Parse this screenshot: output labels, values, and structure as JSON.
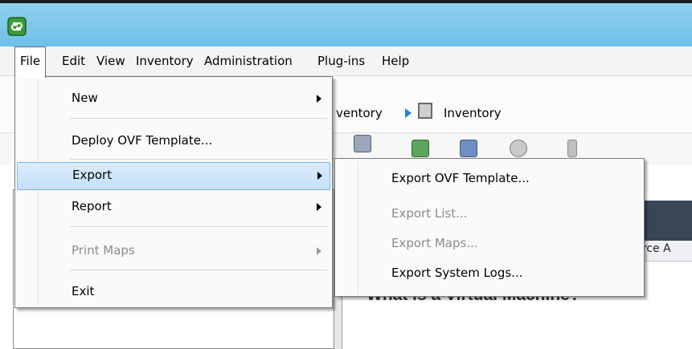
{
  "app": {
    "icon": "vsphere-client-icon"
  },
  "menubar": {
    "items": [
      {
        "label": "File",
        "open": true
      },
      {
        "label": "Edit"
      },
      {
        "label": "View"
      },
      {
        "label": "Inventory"
      },
      {
        "label": "Administration"
      },
      {
        "label": "Plug-ins"
      },
      {
        "label": "Help"
      }
    ]
  },
  "breadcrumbs": {
    "first": "ventory",
    "second": "Inventory"
  },
  "file_menu": {
    "items": [
      {
        "label": "New",
        "submenu": true,
        "enabled": true
      },
      {
        "label": "Deploy OVF Template...",
        "enabled": true
      },
      {
        "label": "Export",
        "submenu": true,
        "enabled": true,
        "highlighted": true
      },
      {
        "label": "Report",
        "submenu": true,
        "enabled": true
      },
      {
        "label": "Print Maps",
        "submenu": true,
        "enabled": false
      },
      {
        "label": "Exit",
        "enabled": true
      }
    ]
  },
  "export_submenu": {
    "items": [
      {
        "label": "Export OVF Template...",
        "enabled": true
      },
      {
        "label": "Export List...",
        "enabled": false
      },
      {
        "label": "Export Maps...",
        "enabled": false
      },
      {
        "label": "Export System Logs...",
        "enabled": true
      }
    ]
  },
  "content": {
    "tab_fragment": "urce A",
    "heading": "What is a Virtual Machine?"
  },
  "colors": {
    "titlebar": "#7ec8ea",
    "highlight": "#c4e0fc",
    "disabled_text": "#8b8b8b",
    "content_band": "#3a4656"
  }
}
